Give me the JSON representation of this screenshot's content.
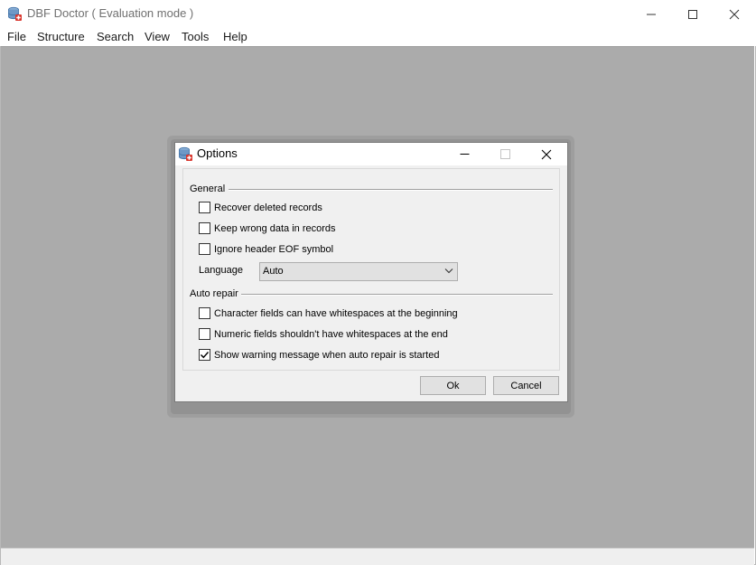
{
  "app": {
    "title": "DBF Doctor ( Evaluation mode )",
    "icon": "database-icon"
  },
  "menu": [
    "File",
    "Structure",
    "Search",
    "View",
    "Tools",
    "Help"
  ],
  "dialog": {
    "title": "Options",
    "general": {
      "label": "General",
      "options": [
        {
          "label": "Recover deleted records",
          "checked": false
        },
        {
          "label": "Keep wrong data in records",
          "checked": false
        },
        {
          "label": "Ignore header EOF symbol",
          "checked": false
        }
      ],
      "language_label": "Language",
      "language_value": "Auto"
    },
    "auto_repair": {
      "label": "Auto repair",
      "options": [
        {
          "label": "Character fields can have whitespaces at the beginning",
          "checked": false
        },
        {
          "label": "Numeric fields shouldn't have whitespaces at the end",
          "checked": false
        },
        {
          "label": "Show warning message when auto repair is started",
          "checked": true
        }
      ]
    },
    "ok_label": "Ok",
    "cancel_label": "Cancel"
  },
  "colors": {
    "workspace": "#ababab",
    "dialog_bg": "#f0f0f0"
  }
}
